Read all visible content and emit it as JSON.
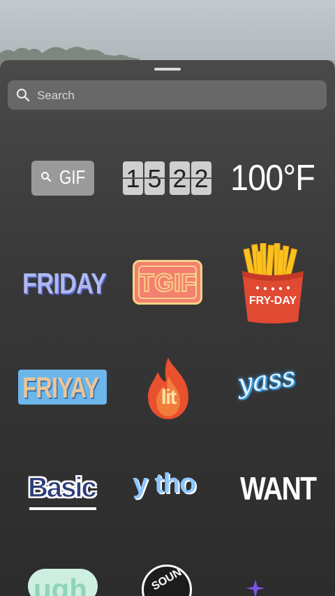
{
  "search": {
    "placeholder": "Search"
  },
  "stickers": {
    "gif_label": "GIF",
    "clock_digits": [
      "1",
      "5",
      "2",
      "2"
    ],
    "temperature": "100°F",
    "friday": "FRIDAY",
    "tgif": "TGIF",
    "fryday": "FRY-DAY",
    "friyay": "FRIYAY",
    "lit": "lit",
    "yass": "yass",
    "basic": "Basic",
    "ytho": "y tho",
    "want": "WANT",
    "ugh": "ugh",
    "sound": "SOUN"
  },
  "colors": {
    "sheet_bg": "#3a3a3a",
    "search_bg": "rgba(255,255,255,0.18)"
  }
}
